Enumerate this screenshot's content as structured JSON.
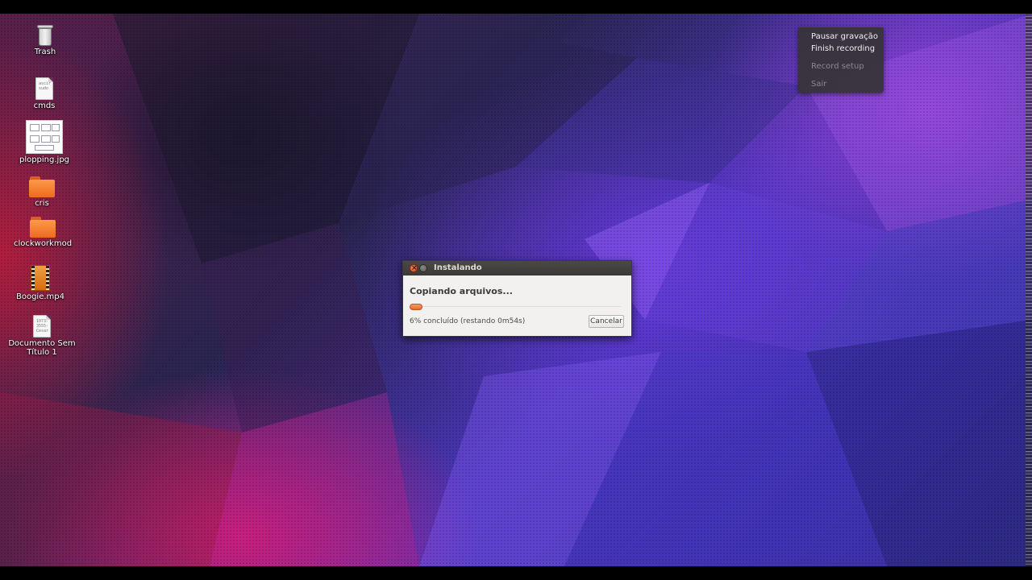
{
  "desktop": {
    "icons": [
      {
        "label": "Trash",
        "icon": "trash-icon"
      },
      {
        "label": "cmds",
        "icon": "text-file-icon",
        "preview": [
          "ascir",
          "sudo"
        ]
      },
      {
        "label": "plopping.jpg",
        "icon": "image-file-icon"
      },
      {
        "label": "cris",
        "icon": "folder-icon"
      },
      {
        "label": "clockworkmod",
        "icon": "folder-icon"
      },
      {
        "label": "Boogie.mp4",
        "icon": "video-file-icon"
      },
      {
        "label": "Documento Sem Título 1",
        "icon": "text-file-icon",
        "preview": [
          "1073-",
          "3555-",
          "Cesar"
        ]
      }
    ]
  },
  "recording_menu": {
    "items": [
      {
        "label": "Pausar gravação",
        "enabled": true
      },
      {
        "label": "Finish recording",
        "enabled": true
      },
      {
        "label": "Record setup",
        "enabled": false
      },
      {
        "label": "Sair",
        "enabled": false
      }
    ]
  },
  "dialog": {
    "title": "Instalando",
    "heading": "Copiando arquivos...",
    "progress_fraction": 0.06,
    "status": "6% concluído (restando 0m54s)",
    "cancel_label": "Cancelar"
  },
  "colors": {
    "progress": "#e8692c",
    "accent_close": "#df4a16",
    "folder": "#ef6a1c"
  }
}
